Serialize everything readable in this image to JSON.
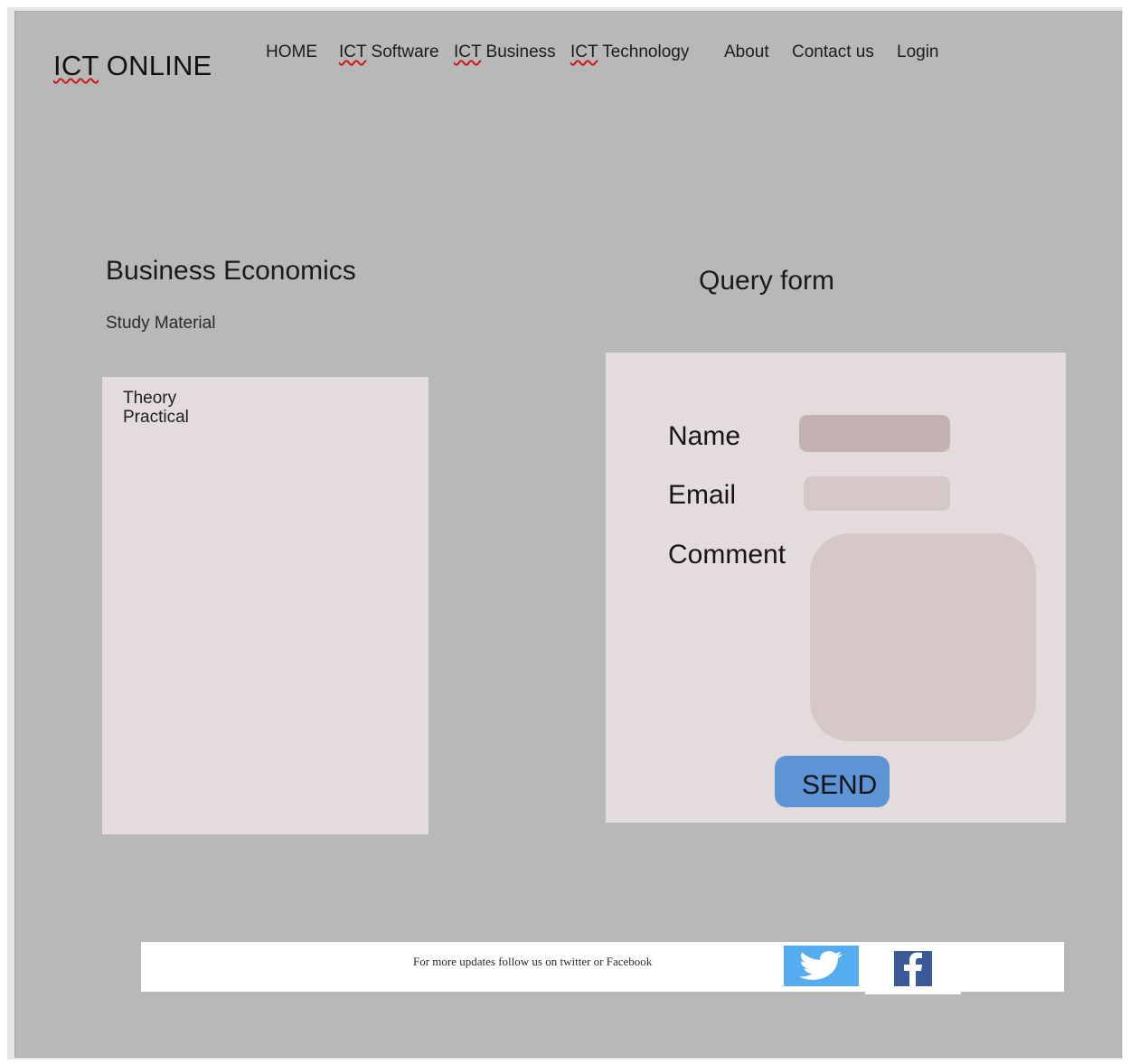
{
  "header": {
    "brand": "ICT ONLINE",
    "nav": [
      {
        "label": "HOME"
      },
      {
        "label": "ICT Software"
      },
      {
        "label": "ICT Business"
      },
      {
        "label": "ICT Technology"
      },
      {
        "label": "About"
      },
      {
        "label": "Contact us"
      },
      {
        "label": "Login"
      }
    ]
  },
  "material": {
    "title": "Business Economics",
    "subtitle": "Study Material",
    "items": [
      "Theory",
      "Practical"
    ]
  },
  "query_form": {
    "title": "Query form",
    "name_label": "Name",
    "email_label": "Email",
    "comment_label": "Comment",
    "name_value": "",
    "email_value": "",
    "comment_value": "",
    "send_label": "SEND"
  },
  "footer": {
    "text": "For more updates follow us on twitter or Facebook",
    "icons": [
      "twitter-icon",
      "facebook-icon"
    ]
  },
  "colors": {
    "page_background": "#b8b8b8",
    "panel_background": "#e4dcdc",
    "name_input": "#c5b1b1",
    "input": "#d5c7c7",
    "send_button": "#5e93d6",
    "twitter": "#55acee",
    "facebook": "#3b5998",
    "spellcheck_underline": "#d01616"
  }
}
